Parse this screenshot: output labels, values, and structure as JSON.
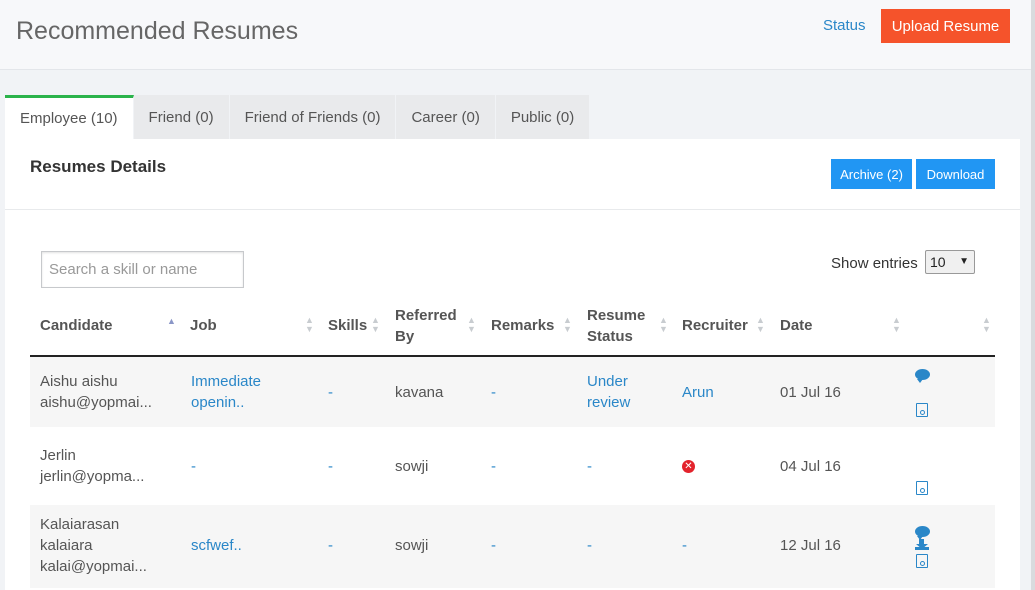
{
  "header": {
    "title": "Recommended Resumes",
    "status_link": "Status",
    "upload_button": "Upload Resume"
  },
  "tabs": [
    {
      "label": "Employee (10)",
      "active": true
    },
    {
      "label": "Friend (0)",
      "active": false
    },
    {
      "label": "Friend of Friends (0)",
      "active": false
    },
    {
      "label": "Career (0)",
      "active": false
    },
    {
      "label": "Public (0)",
      "active": false
    }
  ],
  "panel": {
    "title": "Resumes Details",
    "archive_button": "Archive (2)",
    "download_button": "Download",
    "search_placeholder": "Search a skill or name",
    "entries_label": "Show entries",
    "entries_value": "10"
  },
  "table": {
    "columns": {
      "candidate": "Candidate",
      "job": "Job",
      "skills": "Skills",
      "referred_by_1": "Referred",
      "referred_by_2": "By",
      "remarks": "Remarks",
      "resume_status_1": "Resume",
      "resume_status_2": "Status",
      "recruiter": "Recruiter",
      "date": "Date"
    },
    "rows": [
      {
        "candidate_line1": "Aishu aishu",
        "candidate_line2": "aishu@yopmai...",
        "job_line1": "Immediate",
        "job_line2": "openin..",
        "skills": "-",
        "referred_by": "kavana",
        "remarks": "-",
        "status_line1": "Under",
        "status_line2": "review",
        "recruiter": "Arun",
        "date": "01 Jul 16",
        "actions": [
          "comment-icon",
          "resume-file-icon"
        ]
      },
      {
        "candidate_line1": "Jerlin",
        "candidate_line2": "jerlin@yopma...",
        "job": "-",
        "skills": "-",
        "referred_by": "sowji",
        "remarks": "-",
        "status": "-",
        "recruiter_icon": "remove-circle-icon",
        "date": "04 Jul 16",
        "actions": [
          "resume-file-icon"
        ]
      },
      {
        "candidate_line1": "Kalaiarasan",
        "candidate_line2": "kalaiara",
        "candidate_line3": "kalai@yopmai...",
        "job": "scfwef..",
        "skills": "-",
        "referred_by": "sowji",
        "remarks": "-",
        "status": "-",
        "recruiter": "-",
        "date": "12 Jul 16",
        "actions": [
          "comment-icon",
          "download-icon",
          "resume-file-icon"
        ]
      }
    ]
  },
  "colors": {
    "accent": "#2196f3",
    "upload": "#f5532b",
    "active_tab": "#2bb34b",
    "link": "#2a87c8",
    "error": "#e3232c"
  }
}
